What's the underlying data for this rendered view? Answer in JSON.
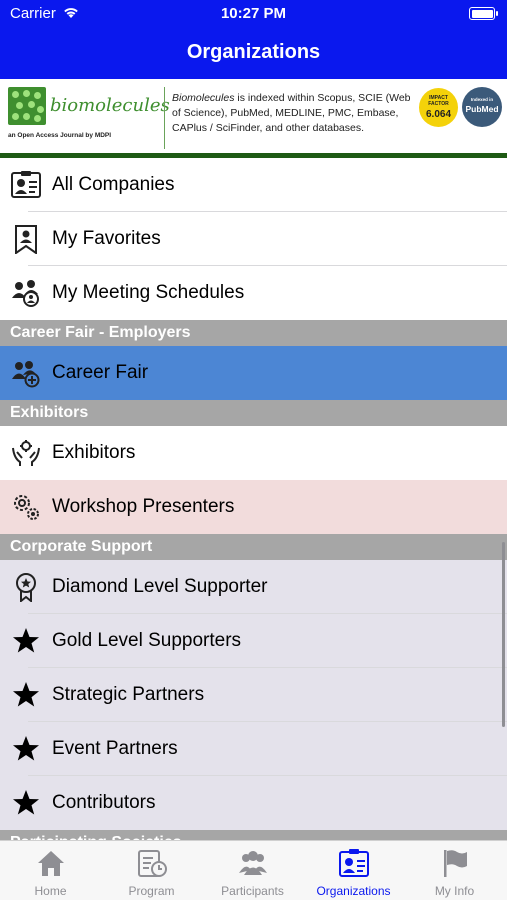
{
  "status_bar": {
    "carrier": "Carrier",
    "time": "10:27 PM",
    "wifi_icon": "wifi-icon",
    "battery_icon": "battery-icon"
  },
  "nav": {
    "title": "Organizations"
  },
  "banner": {
    "logo_name": "biomolecules",
    "logo_sub": "an Open Access Journal by MDPI",
    "description_journal": "Biomolecules",
    "description_rest": " is indexed within Scopus, SCIE (Web of Science), PubMed, MEDLINE, PMC, Embase, CAPlus / SciFinder, and other databases.",
    "impact_label": "IMPACT FACTOR",
    "impact_value": "6.064",
    "pubmed_label": "Indexed in",
    "pubmed_name": "PubMed"
  },
  "menu": {
    "all_companies": "All Companies",
    "my_favorites": "My Favorites",
    "my_meeting_schedules": "My Meeting Schedules"
  },
  "sections": {
    "career_fair": "Career Fair - Employers",
    "exhibitors": "Exhibitors",
    "corporate_support": "Corporate Support",
    "participating_societies": "Participating Societies"
  },
  "career_fair": {
    "career_fair": "Career Fair"
  },
  "exhibitors": {
    "exhibitors": "Exhibitors",
    "workshop_presenters": "Workshop Presenters"
  },
  "corporate_support": {
    "diamond": "Diamond Level Supporter",
    "gold": "Gold Level Supporters",
    "strategic": "Strategic Partners",
    "event": "Event Partners",
    "contributors": "Contributors"
  },
  "tabs": {
    "home": "Home",
    "program": "Program",
    "participants": "Participants",
    "organizations": "Organizations",
    "my_info": "My Info"
  },
  "colors": {
    "nav_blue": "#0a18ee",
    "career_fair_row": "#4c86d4",
    "workshop_row": "#f2dcdc",
    "support_rows": "#e4e2eb",
    "section_header": "#a6a6a6"
  }
}
